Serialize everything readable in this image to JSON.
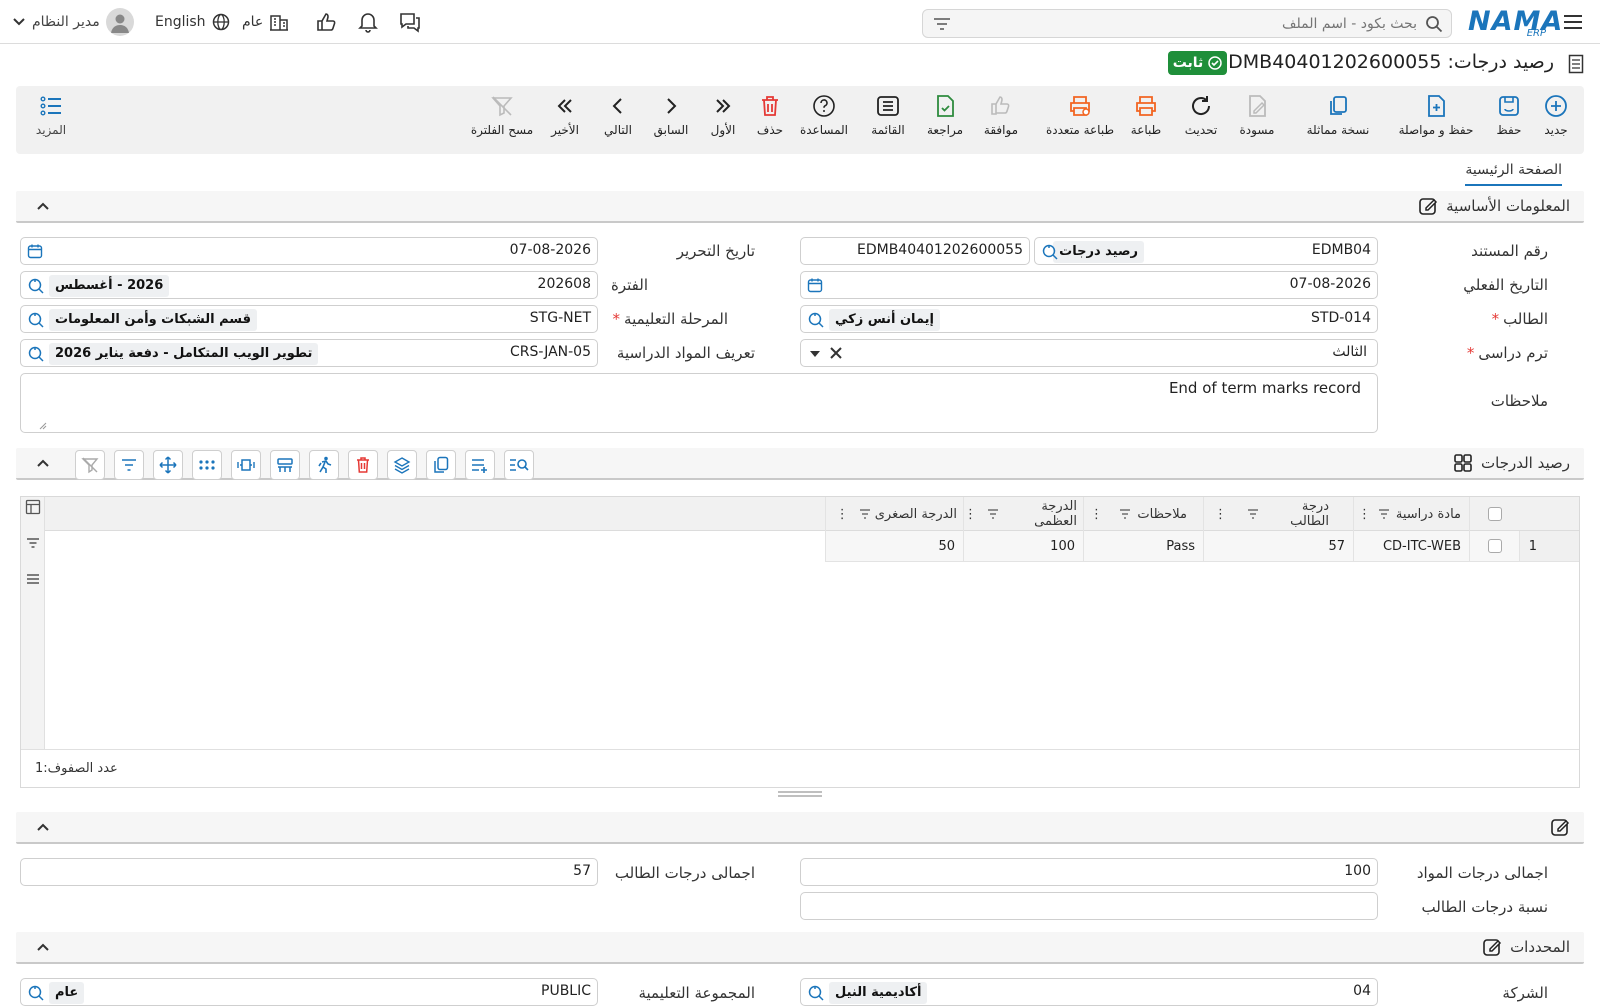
{
  "topbar": {
    "brand": "NAMA",
    "brand_sub": "ERP",
    "search_placeholder": "بحث بكود - اسم الملف",
    "user_label": "مدير النظام",
    "language_label": "English",
    "branch_label": "عام"
  },
  "document": {
    "title": "رصيد درجات: EDMB40401202600055",
    "status": "ثابت"
  },
  "toolbar": {
    "new": "جديد",
    "save": "حفظ",
    "save_continue": "حفظ و مواصلة",
    "duplicate": "نسخة مماثلة",
    "draft": "مسودة",
    "refresh": "تحديث",
    "print": "طباعة",
    "multi_print": "طباعة متعددة",
    "approve": "موافقة",
    "review": "مراجعة",
    "list": "القائمة",
    "help": "المساعدة",
    "delete": "حذف",
    "first": "الأول",
    "previous": "السابق",
    "next": "التالي",
    "last": "الأخير",
    "clear_filter": "مسح الفلترة",
    "more": "المزيد"
  },
  "tabs": {
    "main": "الصفحة الرئيسية"
  },
  "basic_info": {
    "title": "المعلومات الأساسية",
    "doc_number_label": "رقم المستند",
    "doc_code": "EDMB04",
    "doc_type": "رصيد درجات",
    "doc_number": "EDMB40401202600055",
    "edit_date_label": "تاريخ التحرير",
    "edit_date": "07-08-2026",
    "actual_date_label": "التاريخ الفعلي",
    "actual_date": "07-08-2026",
    "period_label": "الفترة",
    "period_code": "202608",
    "period_name": "2026 - أغسطس",
    "student_label": "الطالب",
    "student_code": "STD-014",
    "student_name": "إيمان أنس زكي",
    "stage_label": "المرحلة التعليمية",
    "stage_code": "STG-NET",
    "stage_name": "قسم الشبكات وأمن المعلومات",
    "term_label": "ترم دراسى",
    "term_value": "الثالث",
    "courses_label": "تعريف المواد الدراسية",
    "courses_code": "CRS-JAN-05",
    "courses_name": "تطوير الويب المتكامل - دفعة يناير 2026",
    "notes_label": "ملاحظات",
    "notes_value": "End of term marks record"
  },
  "grades": {
    "title": "رصيد الدرجات",
    "columns": [
      "مادة دراسية",
      "درجة الطالب",
      "ملاحظات",
      "الدرجة العظمى",
      "الدرجة الصغرى"
    ],
    "rows": [
      {
        "index": "1",
        "subject": "CD-ITC-WEB",
        "student_grade": "57",
        "notes": "Pass",
        "max_grade": "100",
        "min_grade": "50"
      }
    ],
    "row_count_label": "عدد الصفوف:",
    "row_count": "1"
  },
  "totals": {
    "subjects_total_label": "اجمالى درجات المواد",
    "subjects_total": "100",
    "student_total_label": "اجمالى درجات الطالب",
    "student_total": "57",
    "student_ratio_label": "نسبة درجات الطالب",
    "student_ratio": ""
  },
  "determinants": {
    "title": "المحددات",
    "company_label": "الشركة",
    "company_code": "04",
    "company_name": "أكاديمية النيل",
    "group_label": "المجموعة التعليمية",
    "group_code": "PUBLIC",
    "group_name": "عام"
  },
  "colors": {
    "primary": "#1b75bb",
    "orange": "#f26522",
    "green": "#2e8b3e",
    "status_green": "#1f8f3a"
  }
}
